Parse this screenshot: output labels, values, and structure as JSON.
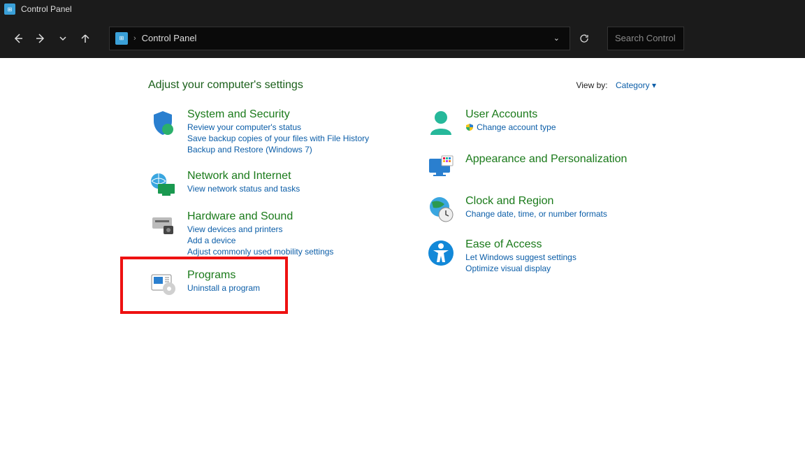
{
  "window": {
    "title": "Control Panel"
  },
  "address": {
    "location": "Control Panel"
  },
  "search": {
    "placeholder": "Search Control Panel"
  },
  "header": {
    "title": "Adjust your computer's settings"
  },
  "viewby": {
    "label": "View by:",
    "value": "Category"
  },
  "left": [
    {
      "title": "System and Security",
      "links": [
        "Review your computer's status",
        "Save backup copies of your files with File History",
        "Backup and Restore (Windows 7)"
      ]
    },
    {
      "title": "Network and Internet",
      "links": [
        "View network status and tasks"
      ]
    },
    {
      "title": "Hardware and Sound",
      "links": [
        "View devices and printers",
        "Add a device",
        "Adjust commonly used mobility settings"
      ]
    },
    {
      "title": "Programs",
      "links": [
        "Uninstall a program"
      ]
    }
  ],
  "right": [
    {
      "title": "User Accounts",
      "links": [
        "Change account type"
      ],
      "shield": true
    },
    {
      "title": "Appearance and Personalization",
      "links": []
    },
    {
      "title": "Clock and Region",
      "links": [
        "Change date, time, or number formats"
      ]
    },
    {
      "title": "Ease of Access",
      "links": [
        "Let Windows suggest settings",
        "Optimize visual display"
      ]
    }
  ]
}
